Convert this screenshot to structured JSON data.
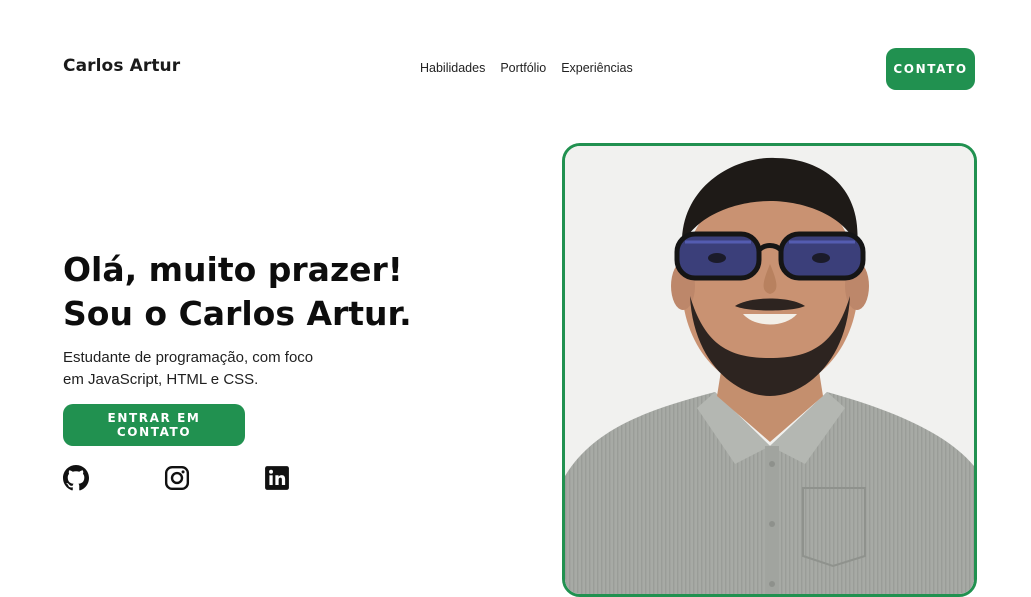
{
  "header": {
    "brand": "Carlos Artur",
    "nav": [
      "Habilidades",
      "Portfólio",
      "Experiências"
    ],
    "contact_label": "CONTATO"
  },
  "hero": {
    "title_line1": "Olá, muito prazer!",
    "title_line2": "Sou o Carlos Artur.",
    "subtitle_line1": "Estudante de programação, com foco",
    "subtitle_line2": "em JavaScript, HTML e CSS.",
    "cta_label": "ENTRAR EM CONTATO"
  },
  "social": [
    {
      "icon": "github-icon"
    },
    {
      "icon": "instagram-icon"
    },
    {
      "icon": "linkedin-icon"
    }
  ],
  "photo": {
    "alt": "Carlos Artur"
  },
  "colors": {
    "accent": "#219150",
    "text": "#111111",
    "background": "#ffffff"
  }
}
